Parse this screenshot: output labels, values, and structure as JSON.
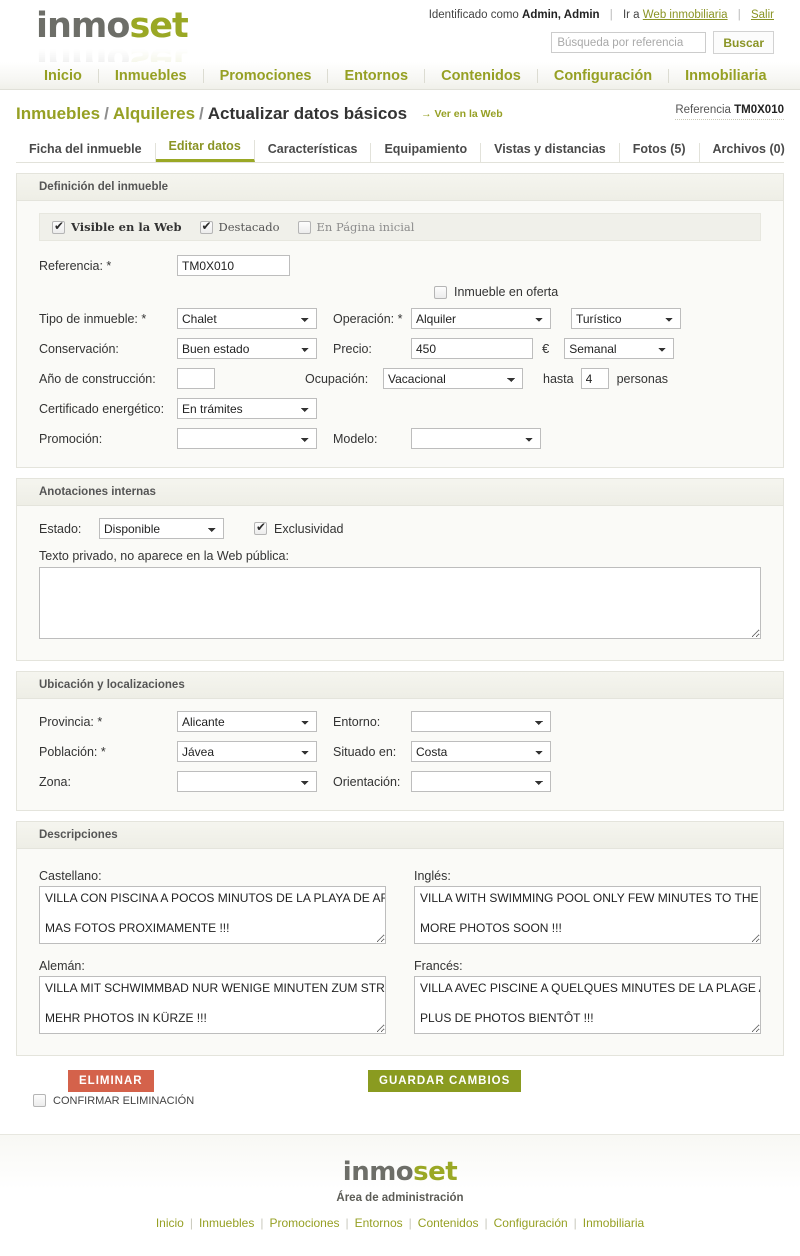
{
  "header": {
    "logo_part1": "inmo",
    "logo_part2": "set",
    "identified_prefix": "Identificado como",
    "identified_user": "Admin, Admin",
    "goto_prefix": "Ir a",
    "goto_link": "Web inmobiliaria",
    "logout": "Salir",
    "search_placeholder": "Búsqueda por referencia",
    "search_value": "",
    "search_button": "Buscar"
  },
  "nav": {
    "items": [
      {
        "label": "Inicio"
      },
      {
        "label": "Inmuebles"
      },
      {
        "label": "Promociones"
      },
      {
        "label": "Entornos"
      },
      {
        "label": "Contenidos"
      },
      {
        "label": "Configuración"
      },
      {
        "label": "Inmobiliaria"
      }
    ]
  },
  "breadcrumb": {
    "level1": "Inmuebles",
    "level2": "Alquileres",
    "current": "Actualizar datos básicos",
    "view_web_link": "→ Ver en la Web",
    "reference_label": "Referencia",
    "reference_value": "TM0X010"
  },
  "tabs": [
    {
      "label": "Ficha del inmueble",
      "active": false
    },
    {
      "label": "Editar datos",
      "active": true
    },
    {
      "label": "Características",
      "active": false
    },
    {
      "label": "Equipamiento",
      "active": false
    },
    {
      "label": "Vistas y distancias",
      "active": false
    },
    {
      "label": "Fotos (5)",
      "active": false
    },
    {
      "label": "Archivos (0)",
      "active": false
    }
  ],
  "section_definition": {
    "title": "Definición del inmueble",
    "check_visible": "Visible en la Web",
    "check_visible_checked": true,
    "check_destacado": "Destacado",
    "check_destacado_checked": true,
    "check_portada": "En Página inicial",
    "check_portada_checked": false,
    "check_oferta": "Inmueble en oferta",
    "check_oferta_checked": false,
    "label_referencia": "Referencia: *",
    "value_referencia": "TM0X010",
    "label_tipo": "Tipo de inmueble: *",
    "value_tipo": "Chalet",
    "label_operacion": "Operación: *",
    "value_operacion": "Alquiler",
    "value_turistico": "Turístico",
    "label_conservacion": "Conservación:",
    "value_conservacion": "Buen estado",
    "label_precio": "Precio:",
    "value_precio": "450",
    "currency": "€",
    "value_periodo": "Semanal",
    "label_anyo": "Año de construcción:",
    "value_anyo": "",
    "label_ocupacion": "Ocupación:",
    "value_ocupacion": "Vacacional",
    "text_hasta": "hasta",
    "value_personas": "4",
    "text_personas": "personas",
    "label_certificado": "Certificado energético:",
    "value_certificado": "En trámites",
    "label_promocion": "Promoción:",
    "value_promocion": "",
    "label_modelo": "Modelo:",
    "value_modelo": ""
  },
  "section_notes": {
    "title": "Anotaciones internas",
    "label_estado": "Estado:",
    "value_estado": "Disponible",
    "check_exclusividad": "Exclusividad",
    "check_exclusividad_checked": true,
    "label_private": "Texto privado, no aparece en la Web pública:",
    "value_private": ""
  },
  "section_location": {
    "title": "Ubicación y localizaciones",
    "label_provincia": "Provincia: *",
    "value_provincia": "Alicante",
    "label_entorno": "Entorno:",
    "value_entorno": "",
    "label_poblacion": "Población: *",
    "value_poblacion": "Jávea",
    "label_situado": "Situado en:",
    "value_situado": "Costa",
    "label_zona": "Zona:",
    "value_zona": "",
    "label_orientacion": "Orientación:",
    "value_orientacion": ""
  },
  "section_descriptions": {
    "title": "Descripciones",
    "label_castellano": "Castellano:",
    "value_castellano": "VILLA CON PISCINA A POCOS MINUTOS DE LA PLAYA DE ARENAL\n\nMAS FOTOS PROXIMAMENTE !!!",
    "label_ingles": "Inglés:",
    "value_ingles": "VILLA WITH SWIMMING POOL ONLY FEW MINUTES TO THE ARENAL BEACH\n\nMORE PHOTOS SOON !!!",
    "label_aleman": "Alemán:",
    "value_aleman": "VILLA MIT SCHWIMMBAD NUR WENIGE MINUTEN ZUM STRAND ARENAL\n\nMEHR PHOTOS IN KÜRZE !!!",
    "label_frances": "Francés:",
    "value_frances": "VILLA AVEC PISCINE A QUELQUES MINUTES DE LA PLAGE ARENAL\n\nPLUS DE PHOTOS BIENTÔT !!!"
  },
  "actions": {
    "delete_label": "ELIMINAR",
    "save_label": "GUARDAR CAMBIOS",
    "confirm_delete_label": "CONFIRMAR ELIMINACIÓN",
    "confirm_delete_checked": false,
    "delete_color": "#d4624b",
    "save_color": "#8a9b20"
  },
  "footer": {
    "logo_part1": "inmo",
    "logo_part2": "set",
    "tagline": "Área de administración",
    "links": [
      {
        "label": "Inicio"
      },
      {
        "label": "Inmuebles"
      },
      {
        "label": "Promociones"
      },
      {
        "label": "Entornos"
      },
      {
        "label": "Contenidos"
      },
      {
        "label": "Configuración"
      },
      {
        "label": "Inmobiliaria"
      }
    ]
  },
  "theme": {
    "accent_green": "#96a024",
    "logo_gray": "#6d6e68"
  }
}
